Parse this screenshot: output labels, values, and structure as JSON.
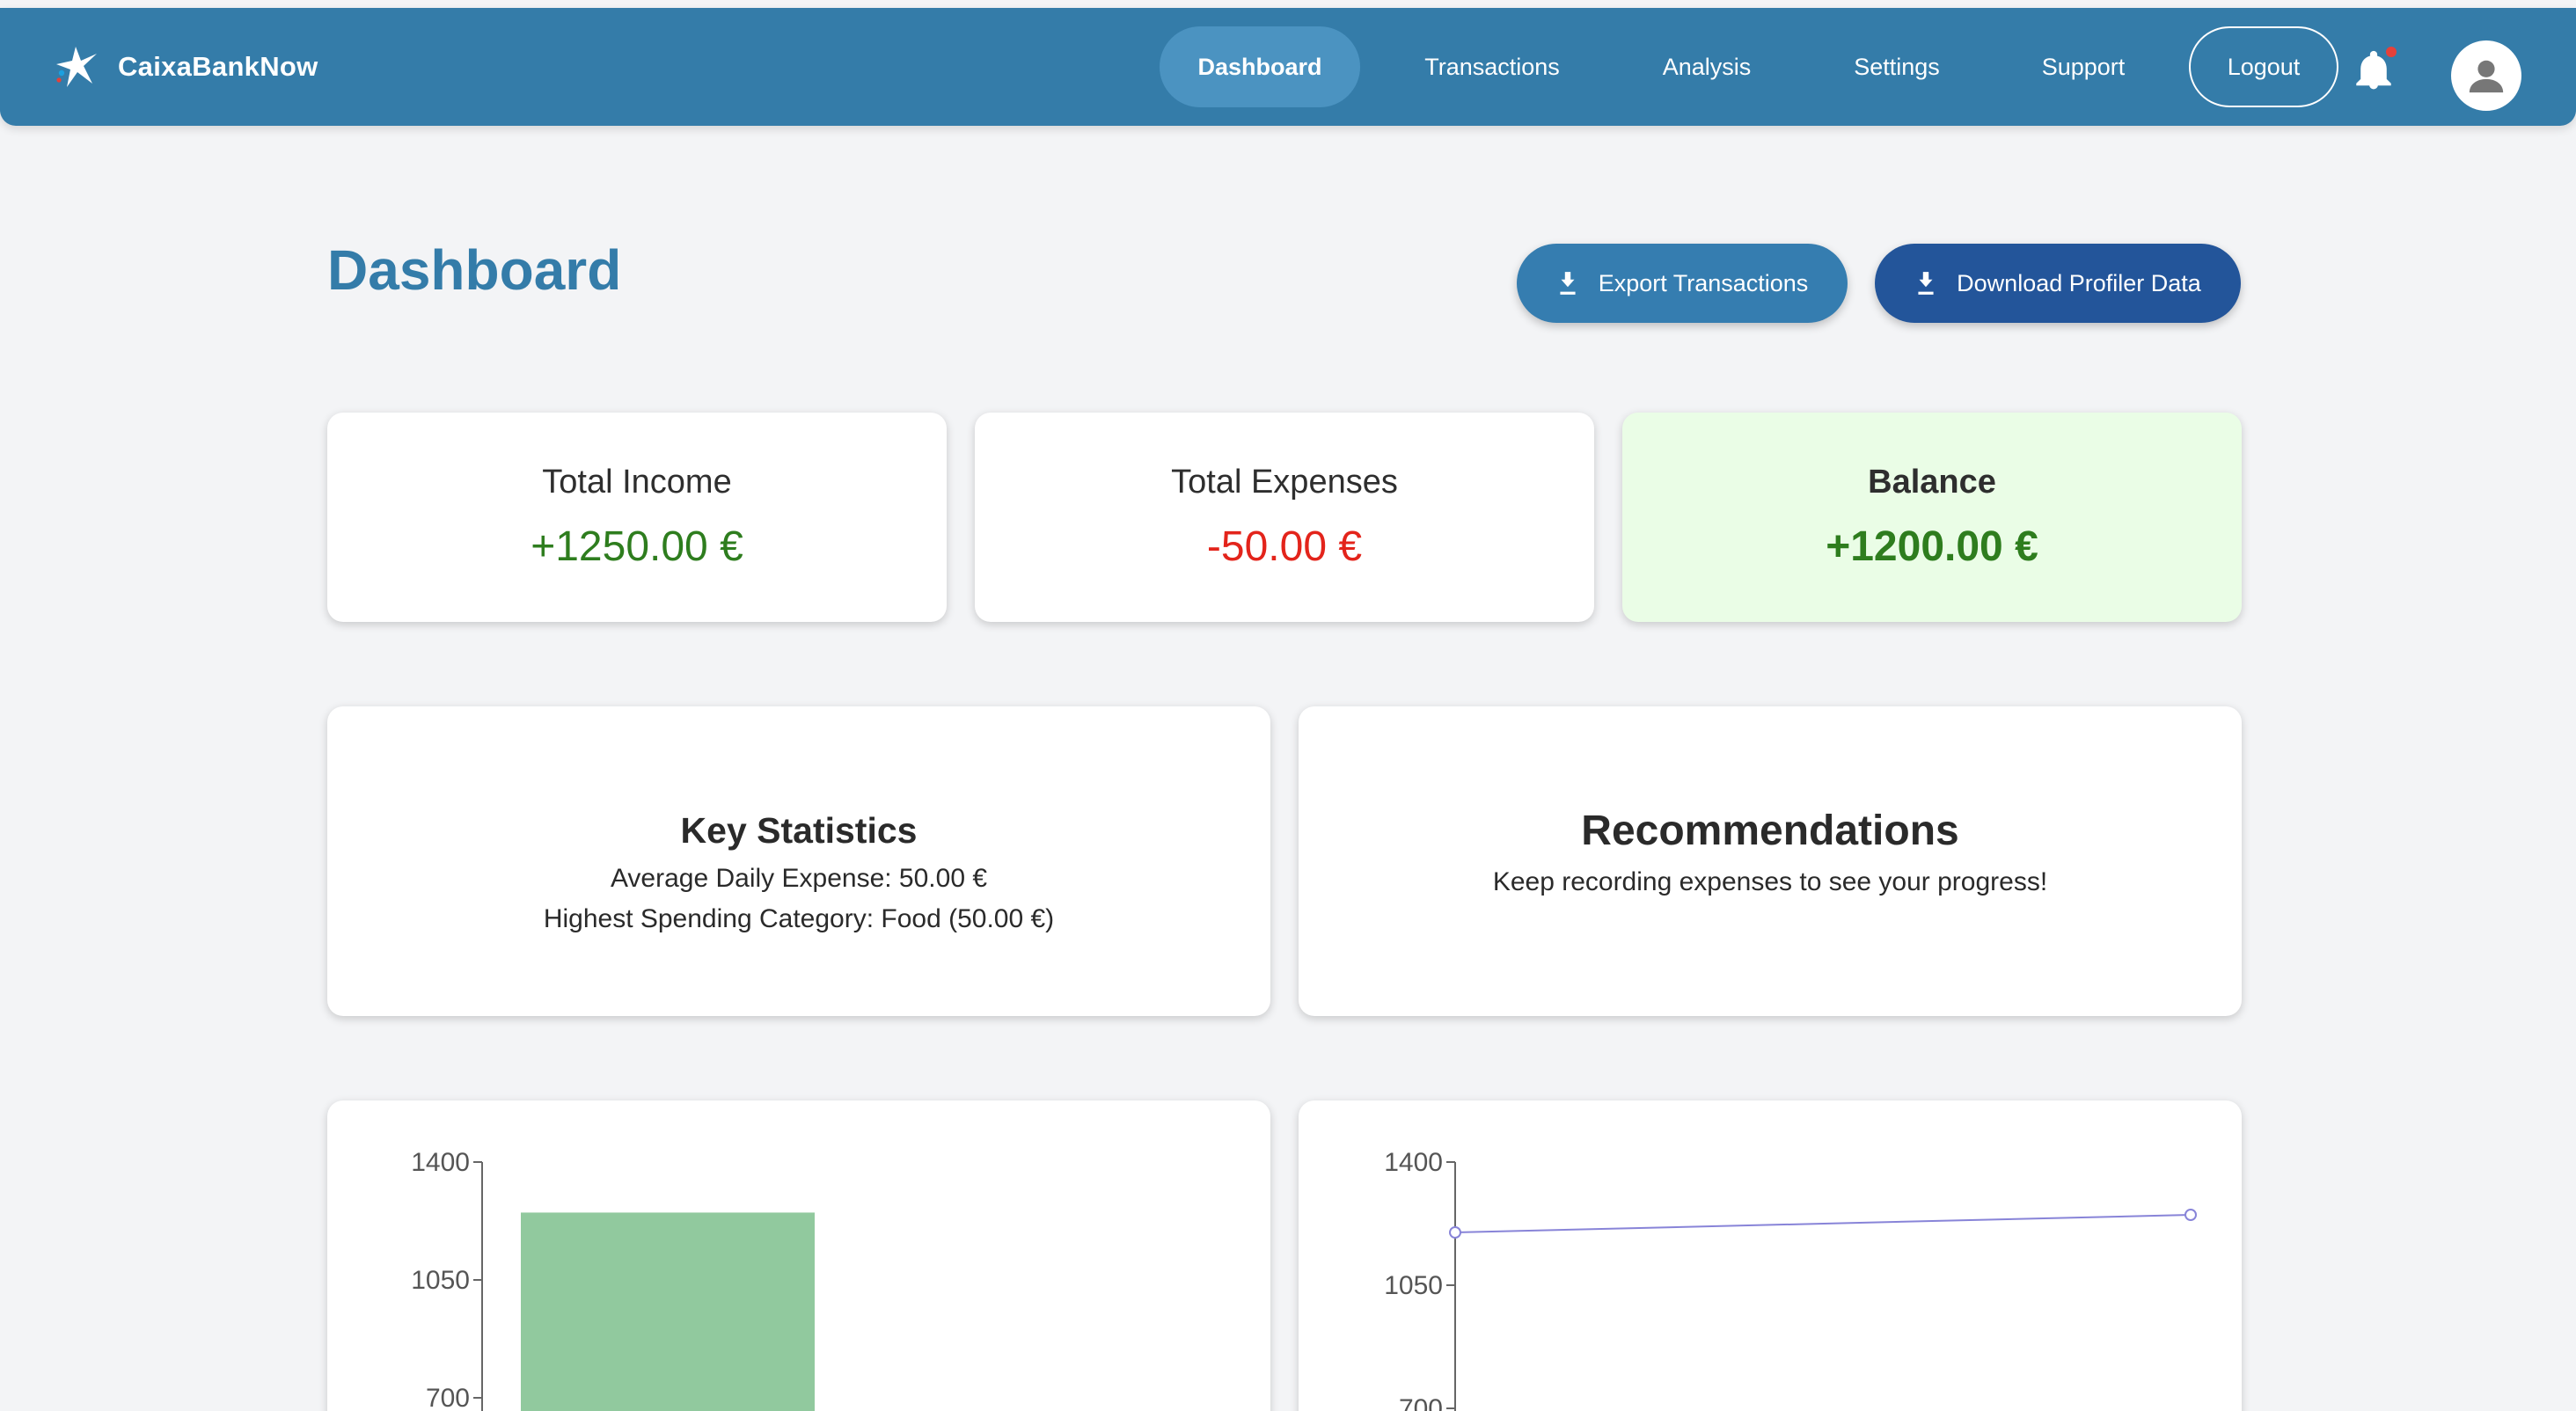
{
  "nav": {
    "brand": "CaixaBankNow",
    "items": [
      "Dashboard",
      "Transactions",
      "Analysis",
      "Settings",
      "Support"
    ],
    "active": "Dashboard",
    "logout": "Logout",
    "notification_dot_color": "#e5413a"
  },
  "header": {
    "title": "Dashboard",
    "export_label": "Export Transactions",
    "profiler_label": "Download Profiler Data"
  },
  "summary": {
    "income_label": "Total Income",
    "income_value": "+1250.00 €",
    "expenses_label": "Total Expenses",
    "expenses_value": "-50.00 €",
    "balance_label": "Balance",
    "balance_value": "+1200.00 €"
  },
  "stats": {
    "title": "Key Statistics",
    "avg_daily": "Average Daily Expense: 50.00 €",
    "highest_category": "Highest Spending Category: Food (50.00 €)"
  },
  "recommendations": {
    "title": "Recommendations",
    "text": "Keep recording expenses to see your progress!"
  },
  "colors": {
    "primary": "#347ca9",
    "dark_button": "#23559a",
    "income": "#2e7d1e",
    "expense": "#e3241b",
    "balance_bg": "#eafde6",
    "bar_fill": "#91c99e",
    "line_stroke": "#8884d8"
  },
  "chart_data": [
    {
      "type": "bar",
      "yticks": [
        "1400",
        "1050",
        "700"
      ],
      "ylim": [
        700,
        1400
      ],
      "values": [
        1250
      ],
      "visible_partial": true
    },
    {
      "type": "line",
      "yticks": [
        "1400",
        "1050",
        "700"
      ],
      "ylim": [
        700,
        1400
      ],
      "values": [
        1200,
        1250
      ],
      "visible_partial": true
    }
  ]
}
